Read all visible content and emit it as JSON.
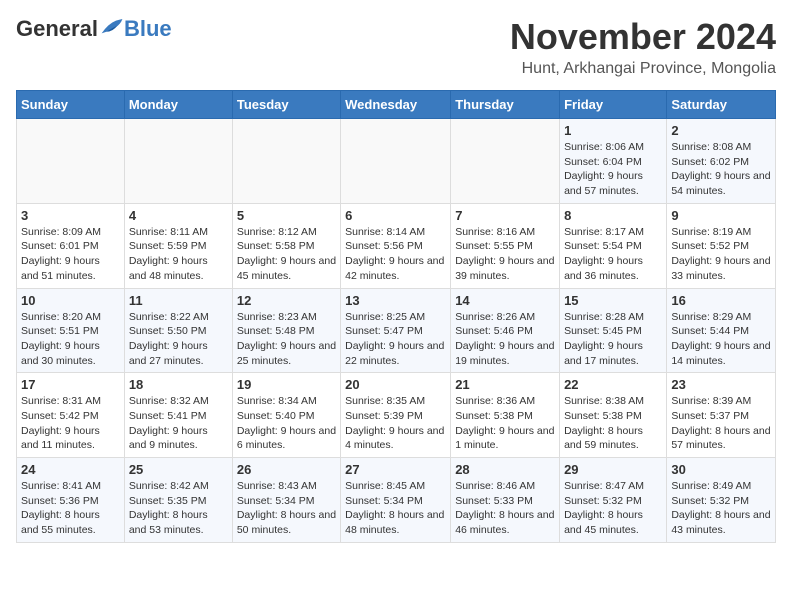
{
  "logo": {
    "general": "General",
    "blue": "Blue"
  },
  "header": {
    "month": "November 2024",
    "location": "Hunt, Arkhangai Province, Mongolia"
  },
  "weekdays": [
    "Sunday",
    "Monday",
    "Tuesday",
    "Wednesday",
    "Thursday",
    "Friday",
    "Saturday"
  ],
  "weeks": [
    [
      {
        "day": "",
        "info": ""
      },
      {
        "day": "",
        "info": ""
      },
      {
        "day": "",
        "info": ""
      },
      {
        "day": "",
        "info": ""
      },
      {
        "day": "",
        "info": ""
      },
      {
        "day": "1",
        "info": "Sunrise: 8:06 AM\nSunset: 6:04 PM\nDaylight: 9 hours and 57 minutes."
      },
      {
        "day": "2",
        "info": "Sunrise: 8:08 AM\nSunset: 6:02 PM\nDaylight: 9 hours and 54 minutes."
      }
    ],
    [
      {
        "day": "3",
        "info": "Sunrise: 8:09 AM\nSunset: 6:01 PM\nDaylight: 9 hours and 51 minutes."
      },
      {
        "day": "4",
        "info": "Sunrise: 8:11 AM\nSunset: 5:59 PM\nDaylight: 9 hours and 48 minutes."
      },
      {
        "day": "5",
        "info": "Sunrise: 8:12 AM\nSunset: 5:58 PM\nDaylight: 9 hours and 45 minutes."
      },
      {
        "day": "6",
        "info": "Sunrise: 8:14 AM\nSunset: 5:56 PM\nDaylight: 9 hours and 42 minutes."
      },
      {
        "day": "7",
        "info": "Sunrise: 8:16 AM\nSunset: 5:55 PM\nDaylight: 9 hours and 39 minutes."
      },
      {
        "day": "8",
        "info": "Sunrise: 8:17 AM\nSunset: 5:54 PM\nDaylight: 9 hours and 36 minutes."
      },
      {
        "day": "9",
        "info": "Sunrise: 8:19 AM\nSunset: 5:52 PM\nDaylight: 9 hours and 33 minutes."
      }
    ],
    [
      {
        "day": "10",
        "info": "Sunrise: 8:20 AM\nSunset: 5:51 PM\nDaylight: 9 hours and 30 minutes."
      },
      {
        "day": "11",
        "info": "Sunrise: 8:22 AM\nSunset: 5:50 PM\nDaylight: 9 hours and 27 minutes."
      },
      {
        "day": "12",
        "info": "Sunrise: 8:23 AM\nSunset: 5:48 PM\nDaylight: 9 hours and 25 minutes."
      },
      {
        "day": "13",
        "info": "Sunrise: 8:25 AM\nSunset: 5:47 PM\nDaylight: 9 hours and 22 minutes."
      },
      {
        "day": "14",
        "info": "Sunrise: 8:26 AM\nSunset: 5:46 PM\nDaylight: 9 hours and 19 minutes."
      },
      {
        "day": "15",
        "info": "Sunrise: 8:28 AM\nSunset: 5:45 PM\nDaylight: 9 hours and 17 minutes."
      },
      {
        "day": "16",
        "info": "Sunrise: 8:29 AM\nSunset: 5:44 PM\nDaylight: 9 hours and 14 minutes."
      }
    ],
    [
      {
        "day": "17",
        "info": "Sunrise: 8:31 AM\nSunset: 5:42 PM\nDaylight: 9 hours and 11 minutes."
      },
      {
        "day": "18",
        "info": "Sunrise: 8:32 AM\nSunset: 5:41 PM\nDaylight: 9 hours and 9 minutes."
      },
      {
        "day": "19",
        "info": "Sunrise: 8:34 AM\nSunset: 5:40 PM\nDaylight: 9 hours and 6 minutes."
      },
      {
        "day": "20",
        "info": "Sunrise: 8:35 AM\nSunset: 5:39 PM\nDaylight: 9 hours and 4 minutes."
      },
      {
        "day": "21",
        "info": "Sunrise: 8:36 AM\nSunset: 5:38 PM\nDaylight: 9 hours and 1 minute."
      },
      {
        "day": "22",
        "info": "Sunrise: 8:38 AM\nSunset: 5:38 PM\nDaylight: 8 hours and 59 minutes."
      },
      {
        "day": "23",
        "info": "Sunrise: 8:39 AM\nSunset: 5:37 PM\nDaylight: 8 hours and 57 minutes."
      }
    ],
    [
      {
        "day": "24",
        "info": "Sunrise: 8:41 AM\nSunset: 5:36 PM\nDaylight: 8 hours and 55 minutes."
      },
      {
        "day": "25",
        "info": "Sunrise: 8:42 AM\nSunset: 5:35 PM\nDaylight: 8 hours and 53 minutes."
      },
      {
        "day": "26",
        "info": "Sunrise: 8:43 AM\nSunset: 5:34 PM\nDaylight: 8 hours and 50 minutes."
      },
      {
        "day": "27",
        "info": "Sunrise: 8:45 AM\nSunset: 5:34 PM\nDaylight: 8 hours and 48 minutes."
      },
      {
        "day": "28",
        "info": "Sunrise: 8:46 AM\nSunset: 5:33 PM\nDaylight: 8 hours and 46 minutes."
      },
      {
        "day": "29",
        "info": "Sunrise: 8:47 AM\nSunset: 5:32 PM\nDaylight: 8 hours and 45 minutes."
      },
      {
        "day": "30",
        "info": "Sunrise: 8:49 AM\nSunset: 5:32 PM\nDaylight: 8 hours and 43 minutes."
      }
    ]
  ]
}
